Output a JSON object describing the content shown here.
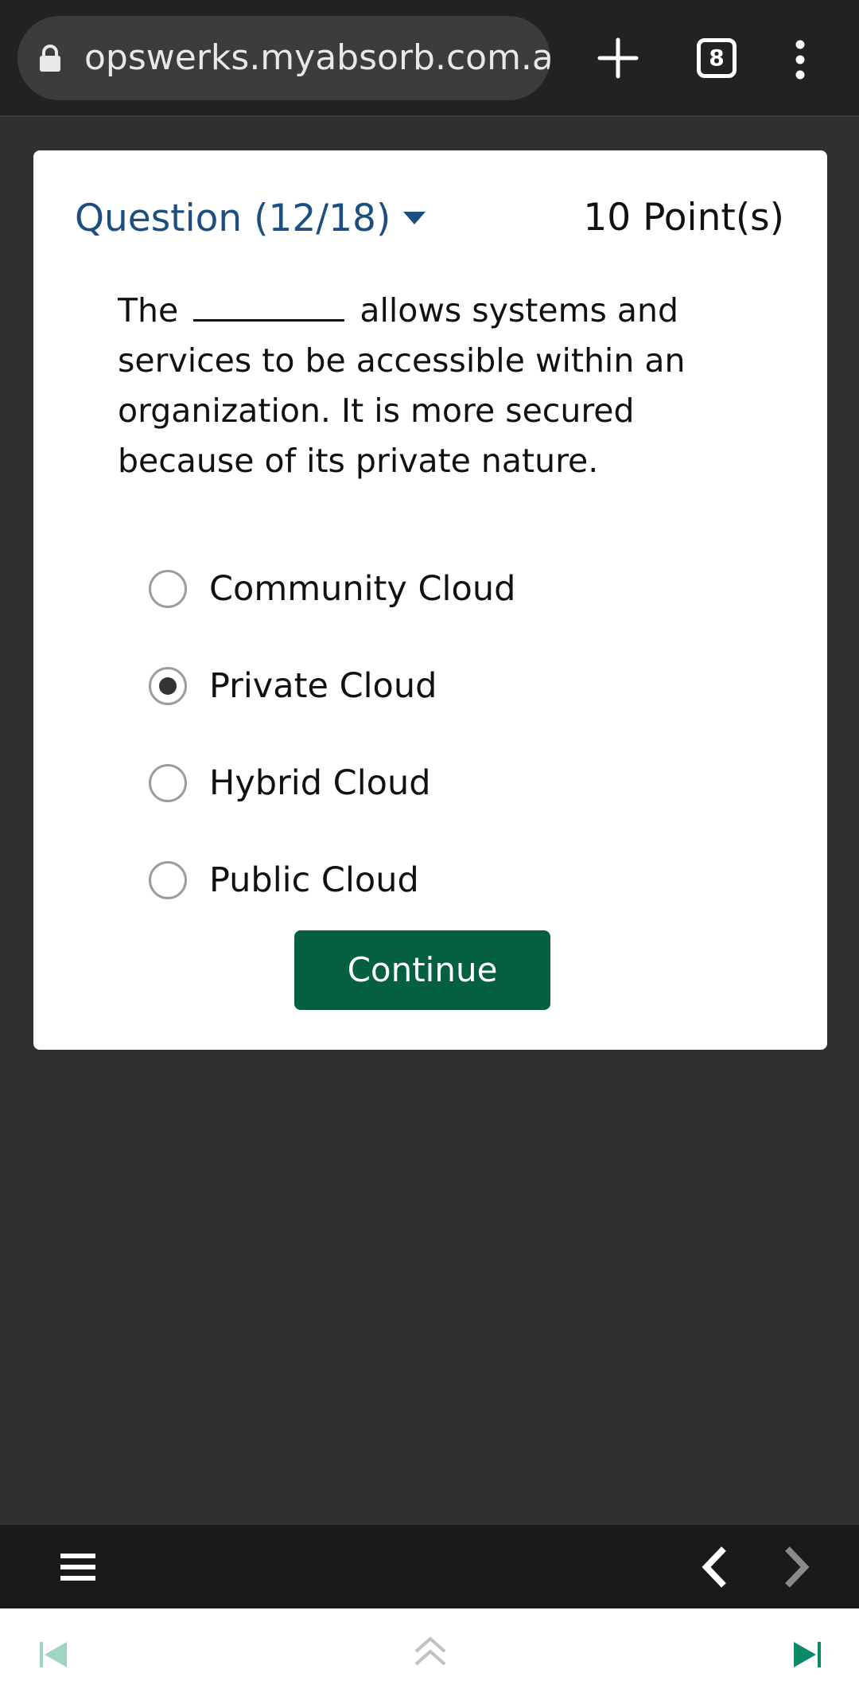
{
  "browser": {
    "url": "opswerks.myabsorb.com.au/",
    "tab_count": "8"
  },
  "quiz": {
    "question_header": "Question (12/18)",
    "points": "10 Point(s)",
    "question_before_blank": "The",
    "question_after_blank": "allows systems and services to be accessible within an organization. It is more secured because of its private nature.",
    "options": [
      {
        "label": "Community Cloud",
        "selected": false
      },
      {
        "label": "Private Cloud",
        "selected": true
      },
      {
        "label": "Hybrid Cloud",
        "selected": false
      },
      {
        "label": "Public Cloud",
        "selected": false
      }
    ],
    "continue_label": "Continue"
  },
  "colors": {
    "accent_green": "#04603e",
    "header_blue": "#1c4e80",
    "teal_icon": "#0a8a66",
    "teal_icon_faded": "#9fd3c4"
  },
  "icons": {
    "lock": "lock-icon",
    "plus": "plus-icon",
    "menu": "more-vert-icon",
    "hamburger": "hamburger-icon",
    "prev": "chevron-left-icon",
    "next": "chevron-right-icon",
    "skip_back": "skip-previous-icon",
    "scroll_up": "double-chevron-up-icon",
    "skip_forward": "skip-next-icon"
  }
}
